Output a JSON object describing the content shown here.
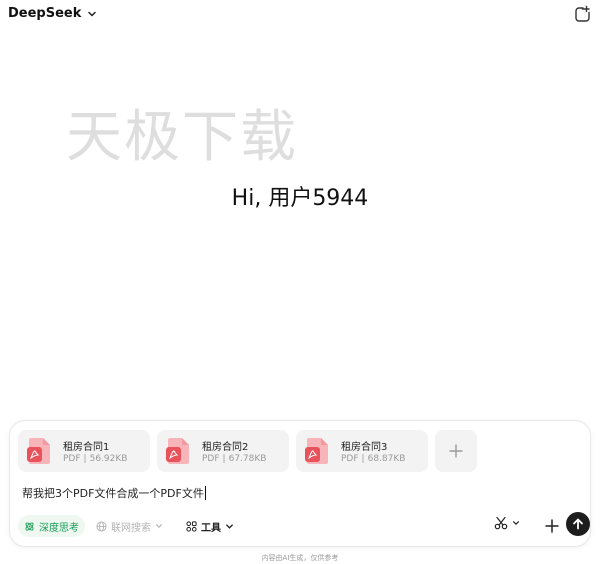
{
  "header": {
    "model_name": "DeepSeek"
  },
  "watermark": "天极下载",
  "greeting": "Hi, 用户5944",
  "attachments": [
    {
      "name": "租房合同1",
      "type": "PDF",
      "size": "56.92KB"
    },
    {
      "name": "租房合同2",
      "type": "PDF",
      "size": "67.78KB"
    },
    {
      "name": "租房合同3",
      "type": "PDF",
      "size": "68.87KB"
    }
  ],
  "composer": {
    "message": "帮我把3个PDF文件合成一个PDF文件",
    "deep_think_label": "深度思考",
    "web_search_label": "联网搜索",
    "tools_label": "工具"
  },
  "footer": {
    "disclaimer": "内容由AI生成，仅供参考"
  },
  "colors": {
    "accent_green": "#1a9b56",
    "pdf_red": "#e8525a",
    "send_bg": "#1d1d1d"
  },
  "icons": [
    "chevron-down-icon",
    "new-chat-icon",
    "pdf-file-icon",
    "plus-icon",
    "atom-icon",
    "globe-icon",
    "tools-icon",
    "scissors-icon",
    "send-icon"
  ]
}
